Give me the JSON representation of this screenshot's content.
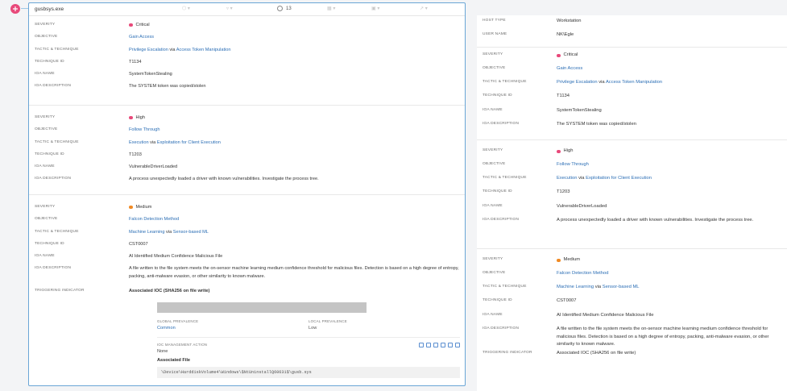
{
  "header": {
    "process_name": "gusbsys.exe",
    "count": "13"
  },
  "labels": {
    "severity": "SEVERITY",
    "objective": "OBJECTIVE",
    "tactic": "TACTIC & TECHNIQUE",
    "technique_id": "TECHNIQUE ID",
    "ioa_name": "IOA NAME",
    "ioa_description": "IOA DESCRIPTION",
    "triggering_indicator": "TRIGGERING INDICATOR",
    "host_type": "HOST TYPE",
    "user_name": "USER NAME",
    "global_prevalence": "GLOBAL PREVALENCE",
    "local_prevalence": "LOCAL PREVALENCE",
    "ioc_management_action": "IOC MANAGEMENT ACTION",
    "via": "via"
  },
  "detections": [
    {
      "severity": "Critical",
      "severity_color": "#e8497a",
      "objective": "Gain Access",
      "tactic": "Privilege Escalation",
      "technique": "Access Token Manipulation",
      "technique_id": "T1134",
      "ioa_name": "SystemTokenStealing",
      "ioa_description": "The SYSTEM token was copied/stolen"
    },
    {
      "severity": "High",
      "severity_color": "#e8497a",
      "objective": "Follow Through",
      "tactic": "Execution",
      "technique": "Exploitation for Client Execution",
      "technique_id": "T1203",
      "ioa_name": "VulnerableDriverLoaded",
      "ioa_description": "A process unexpectedly loaded a driver with known vulnerabilities. Investigate the process tree."
    },
    {
      "severity": "Medium",
      "severity_color": "#f08a24",
      "objective": "Falcon Detection Method",
      "tactic": "Machine Learning",
      "technique": "Sensor-based ML",
      "technique_id": "CST0007",
      "ioa_name": "AI Identified Medium Confidence Malicious File",
      "ioa_description": "A file written to the file system meets the on-sensor machine learning medium confidence threshold for malicious files. Detection is based on a high degree of entropy, packing, anti-malware evasion, or other similarity to known malware.",
      "triggering_indicator": "Associated IOC (SHA256 on file write)"
    }
  ],
  "ioc": {
    "global_prevalence": "Common",
    "local_prevalence": "Low",
    "management_action": "None",
    "associated_file_label": "Associated File",
    "associated_file_path": "\\Device\\HarddiskVolume4\\Windows\\$NtUninstallQ60631$\\gusb.sys"
  },
  "host": {
    "host_type": "Workstation",
    "user_name": "NK\\Egle"
  },
  "icons": [
    "hexagon-icon",
    "filter-icon",
    "pin-icon",
    "target-icon",
    "grid-icon",
    "branch-icon",
    "arrow-icon"
  ],
  "colors": {
    "accent": "#2b6eb5",
    "panel_border": "#6aa6d6",
    "critical": "#e8497a",
    "medium": "#f08a24"
  }
}
